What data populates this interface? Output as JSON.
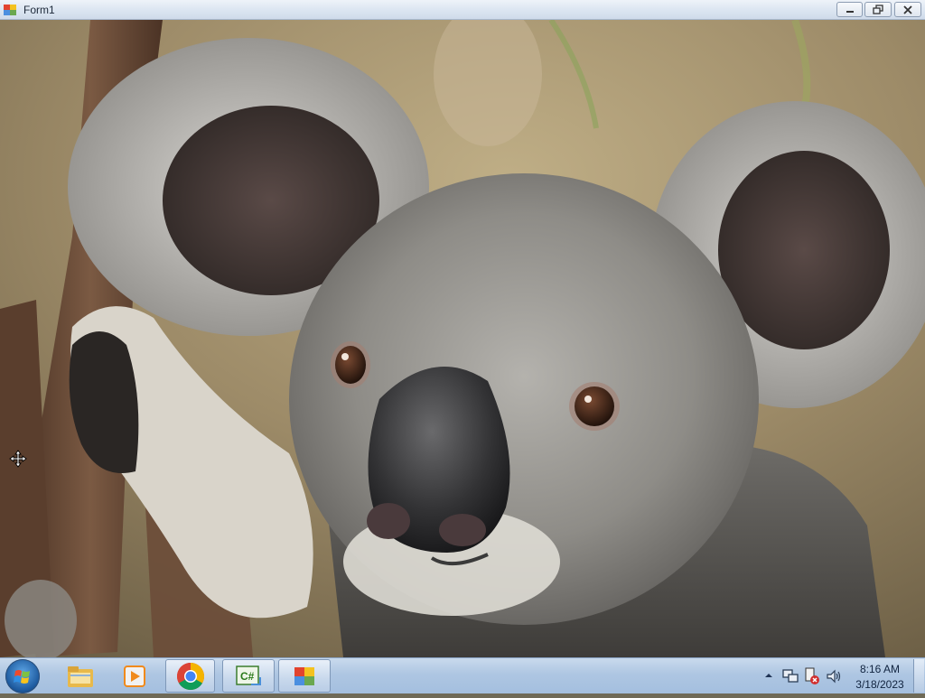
{
  "window": {
    "title": "Form1",
    "controls": {
      "minimize": "minimize-icon",
      "maximize": "restore-icon",
      "close": "close-icon"
    },
    "content": {
      "image_subject": "koala-photo"
    }
  },
  "taskbar": {
    "start": "windows-logo-icon",
    "pinned": [
      {
        "icon": "file-explorer-icon",
        "active": false
      },
      {
        "icon": "media-player-icon",
        "active": false
      },
      {
        "icon": "chrome-icon",
        "active": true
      },
      {
        "icon": "csharp-project-icon",
        "active": true
      },
      {
        "icon": "app-form-icon",
        "active": true
      }
    ],
    "tray": {
      "icons": [
        "show-hidden-icons-icon",
        "network-icon",
        "action-center-icon",
        "volume-icon"
      ],
      "time": "8:16 AM",
      "date": "3/18/2023"
    }
  },
  "colors": {
    "titlebar": "#dbe5f1",
    "taskbar": "#aec6e2",
    "close_accent": "#c9463d"
  }
}
